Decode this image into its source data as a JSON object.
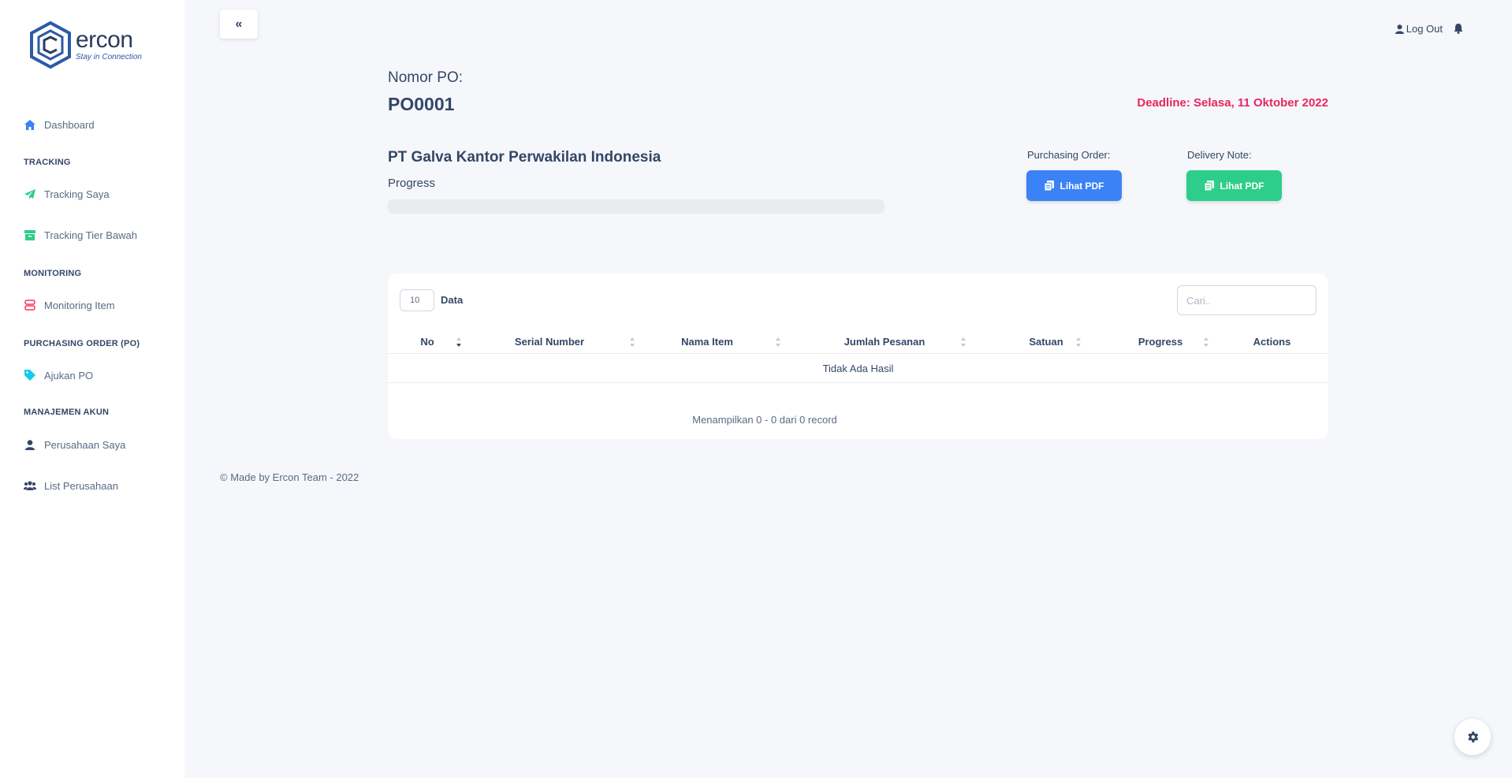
{
  "brand": {
    "name": "ercon",
    "tagline": "Stay in Connection"
  },
  "sidebar": {
    "items": [
      {
        "label": "Dashboard",
        "icon": "home-icon",
        "color": "#3b82f6"
      },
      {
        "section": "TRACKING"
      },
      {
        "label": "Tracking Saya",
        "icon": "paper-plane-icon",
        "color": "#2dce89"
      },
      {
        "label": "Tracking Tier Bawah",
        "icon": "archive-icon",
        "color": "#2dce89"
      },
      {
        "section": "MONITORING"
      },
      {
        "label": "Monitoring Item",
        "icon": "server-icon",
        "color": "#f5365c"
      },
      {
        "section": "PURCHASING ORDER (PO)"
      },
      {
        "label": "Ajukan PO",
        "icon": "tag-icon",
        "color": "#11cdef"
      },
      {
        "section": "MANAJEMEN AKUN"
      },
      {
        "label": "Perusahaan Saya",
        "icon": "user-icon",
        "color": "#344767"
      },
      {
        "label": "List Perusahaan",
        "icon": "users-icon",
        "color": "#344767"
      }
    ]
  },
  "topbar": {
    "collapse_label": "«",
    "logout_label": "Log Out"
  },
  "po": {
    "label": "Nomor PO:",
    "number": "PO0001",
    "deadline": "Deadline: Selasa, 11 Oktober 2022",
    "company": "PT Galva Kantor Perwakilan Indonesia",
    "progress_label": "Progress",
    "progress_value": 0,
    "purchasing_label": "Purchasing Order:",
    "delivery_label": "Delivery Note:",
    "pdf_label": "Lihat PDF"
  },
  "colors": {
    "deadline": "#e8265e",
    "primary": "#3b82f6",
    "success": "#2dce89"
  },
  "table": {
    "page_length": "10",
    "page_length_label": "Data",
    "search_placeholder": "Cari..",
    "columns": [
      "No",
      "Serial Number",
      "Nama Item",
      "Jumlah Pesanan",
      "Satuan",
      "Progress",
      "Actions"
    ],
    "empty_text": "Tidak Ada Hasil",
    "info_text": "Menampilkan 0 - 0 dari 0 record"
  },
  "footer": {
    "text": "© Made by Ercon Team - 2022"
  }
}
